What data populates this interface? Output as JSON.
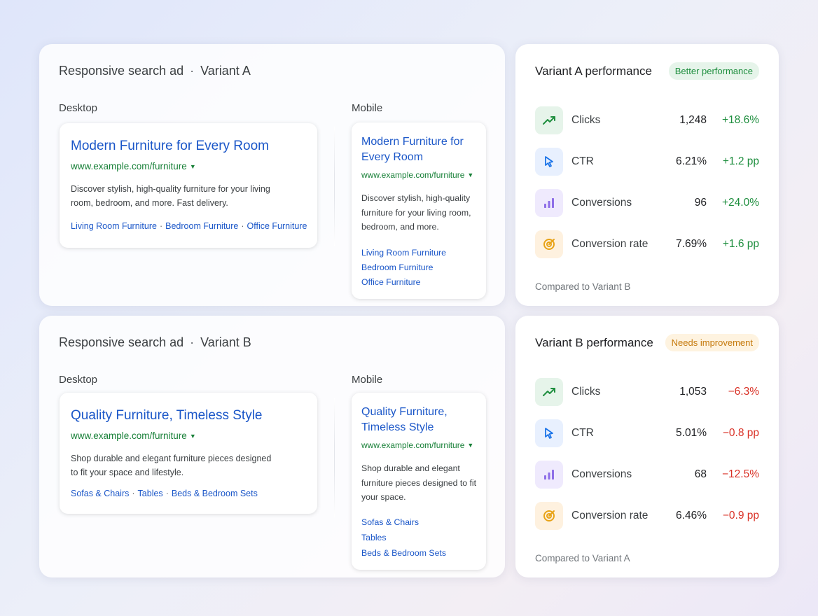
{
  "variant_a": {
    "ad": {
      "title": "Responsive search ad",
      "variant": "Variant A",
      "desktop_label": "Desktop",
      "mobile_label": "Mobile",
      "desktop": {
        "headline": "Modern Furniture for Every Room",
        "url": "www.example.com/furniture",
        "description": "Discover stylish, high-quality furniture for your living room, bedroom, and more. Fast delivery.",
        "links": [
          "Living Room Furniture",
          "Bedroom Furniture",
          "Office Furniture"
        ]
      },
      "mobile": {
        "headline": "Modern Furniture for Every Room",
        "url": "www.example.com/furniture",
        "description": "Discover stylish, high-quality furniture for your living room, bedroom, and more.",
        "links": [
          "Living Room Furniture",
          "Bedroom Furniture",
          "Office Furniture"
        ]
      }
    },
    "performance": {
      "title": "Variant A performance",
      "badge": "Better performance",
      "compare_note": "Compared to Variant B",
      "metrics": [
        {
          "icon": "trending-up-icon",
          "name": "Clicks",
          "value": "1,248",
          "delta": "+18.6%"
        },
        {
          "icon": "cursor-pointer-icon",
          "name": "CTR",
          "value": "6.21%",
          "delta": "+1.2 pp"
        },
        {
          "icon": "bar-chart-icon",
          "name": "Conversions",
          "value": "96",
          "delta": "+24.0%"
        },
        {
          "icon": "target-icon",
          "name": "Conversion rate",
          "value": "7.69%",
          "delta": "+1.6 pp"
        }
      ]
    }
  },
  "variant_b": {
    "ad": {
      "title": "Responsive search ad",
      "variant": "Variant B",
      "desktop_label": "Desktop",
      "mobile_label": "Mobile",
      "desktop": {
        "headline": "Quality Furniture, Timeless Style",
        "url": "www.example.com/furniture",
        "description": "Shop durable and elegant furniture pieces designed to fit your space and lifestyle.",
        "links": [
          "Sofas & Chairs",
          "Tables",
          "Beds & Bedroom Sets"
        ]
      },
      "mobile": {
        "headline": "Quality Furniture, Timeless Style",
        "url": "www.example.com/furniture",
        "description": "Shop durable and elegant furniture pieces designed to fit your space.",
        "links": [
          "Sofas & Chairs",
          "Tables",
          "Beds & Bedroom Sets"
        ]
      }
    },
    "performance": {
      "title": "Variant B performance",
      "badge": "Needs improvement",
      "compare_note": "Compared to Variant A",
      "metrics": [
        {
          "icon": "trending-up-icon",
          "name": "Clicks",
          "value": "1,053",
          "delta": "−6.3%"
        },
        {
          "icon": "cursor-pointer-icon",
          "name": "CTR",
          "value": "5.01%",
          "delta": "−0.8 pp"
        },
        {
          "icon": "bar-chart-icon",
          "name": "Conversions",
          "value": "68",
          "delta": "−12.5%"
        },
        {
          "icon": "target-icon",
          "name": "Conversion rate",
          "value": "6.46%",
          "delta": "−0.9 pp"
        }
      ]
    }
  },
  "colors": {
    "link_blue": "#1a56c8",
    "url_green": "#188038",
    "positive": "#1e8e3e",
    "negative": "#d93025",
    "badge_good_bg": "#e6f4ea",
    "badge_warn_bg": "#fef3e0"
  }
}
